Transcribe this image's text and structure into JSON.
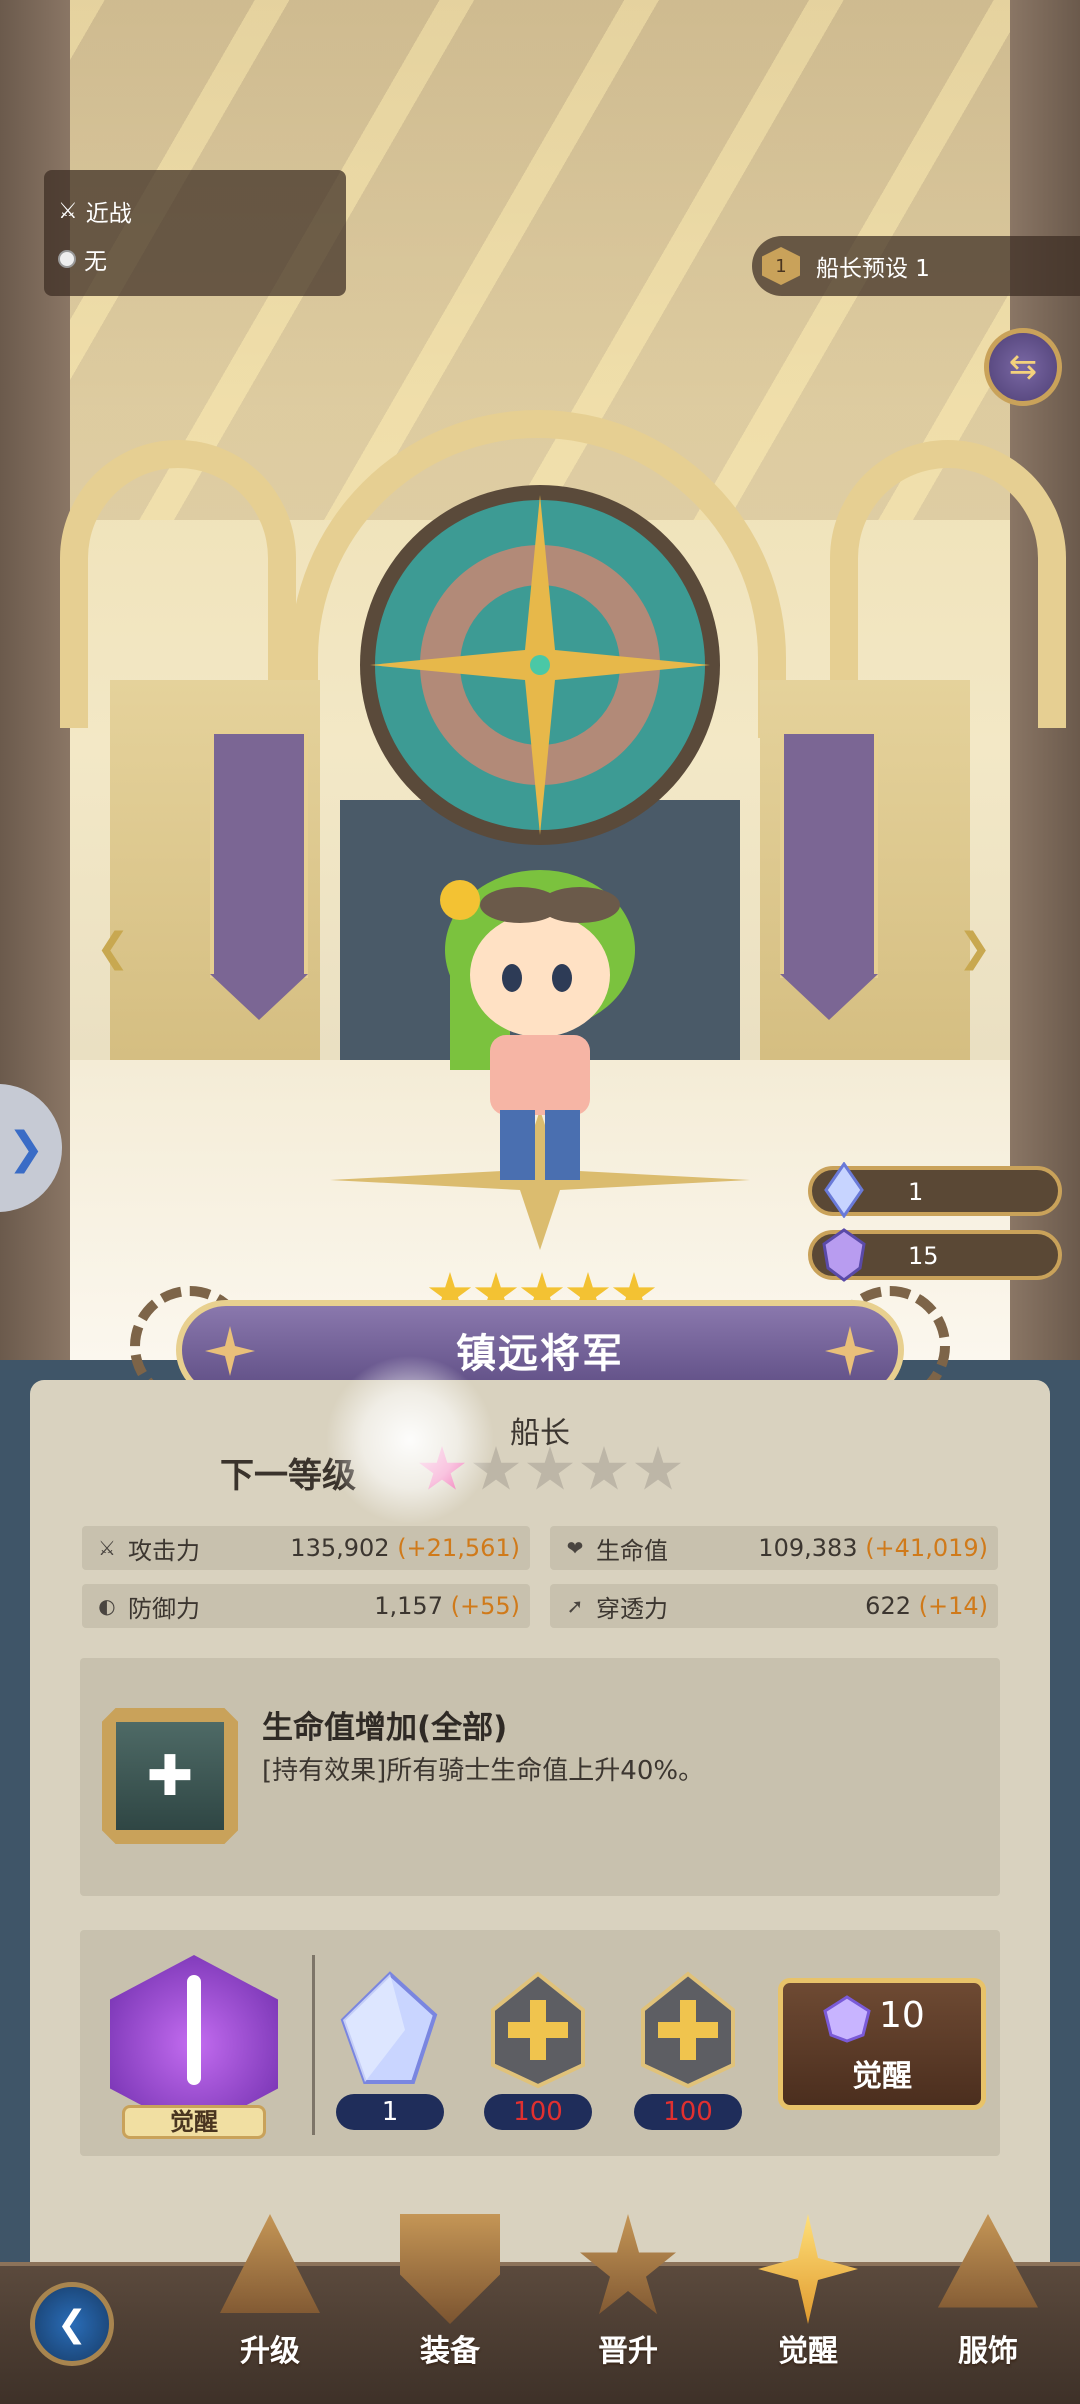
{
  "scene": {
    "attack_type": "近战",
    "element": "无",
    "preset_number": "1",
    "preset_label": "船长预设 1"
  },
  "currencies": [
    {
      "icon": "crystal-shard-icon",
      "value": "1"
    },
    {
      "icon": "gem-icon",
      "value": "15"
    }
  ],
  "hero": {
    "title": "镇远将军",
    "role": "船长",
    "stars": 5
  },
  "next_level": {
    "label": "下一等级",
    "filled_stars": 1,
    "total_stars": 5
  },
  "stats": [
    {
      "icon": "sword-icon",
      "label": "攻击力",
      "value": "135,902",
      "bonus": "(+21,561)"
    },
    {
      "icon": "heart-icon",
      "label": "生命值",
      "value": "109,383",
      "bonus": "(+41,019)"
    },
    {
      "icon": "shield-icon",
      "label": "防御力",
      "value": "1,157",
      "bonus": "(+55)"
    },
    {
      "icon": "pierce-icon",
      "label": "穿透力",
      "value": "622",
      "bonus": "(+14)"
    }
  ],
  "effect": {
    "title": "生命值增加(全部)",
    "description": "[持有效果]所有骑士生命值上升40%。"
  },
  "awaken": {
    "emblem_label": "觉醒",
    "materials": [
      {
        "icon": "crystal-icon",
        "count": "1"
      },
      {
        "icon": "plus-stone-icon",
        "count": "100"
      },
      {
        "icon": "plus-stone-icon",
        "count": "100"
      }
    ],
    "button": {
      "cost": "10",
      "label": "觉醒"
    }
  },
  "nav": [
    {
      "label": "升级",
      "active": false
    },
    {
      "label": "装备",
      "active": false
    },
    {
      "label": "晋升",
      "active": false
    },
    {
      "label": "觉醒",
      "active": true
    },
    {
      "label": "服饰",
      "active": false
    }
  ],
  "colors": {
    "accent_gold": "#c9a25a",
    "bonus_orange": "#d07a1a",
    "title_plate": "#6e5d95",
    "panel_bg": "#d9d2bf",
    "material_count_bad": "#e03030"
  }
}
